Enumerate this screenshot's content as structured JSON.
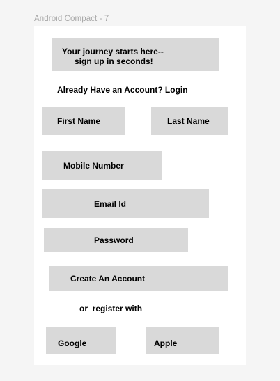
{
  "frame": {
    "label": "Android Compact - 7"
  },
  "header": {
    "line1": "Your journey starts here--",
    "line2": "sign up in seconds!"
  },
  "login_prompt": "Already Have an Account? Login",
  "form": {
    "first_name": "First Name",
    "last_name": "Last Name",
    "mobile_number": "Mobile Number",
    "email": "Email Id",
    "password": "Password"
  },
  "actions": {
    "create_account": "Create An Account",
    "register_with": "or  register with",
    "google": "Google",
    "apple": "Apple"
  },
  "colors": {
    "background": "#f5f5f5",
    "frame": "#ffffff",
    "placeholder_box": "#d9d9d9",
    "frame_label": "#a8a8a8"
  }
}
